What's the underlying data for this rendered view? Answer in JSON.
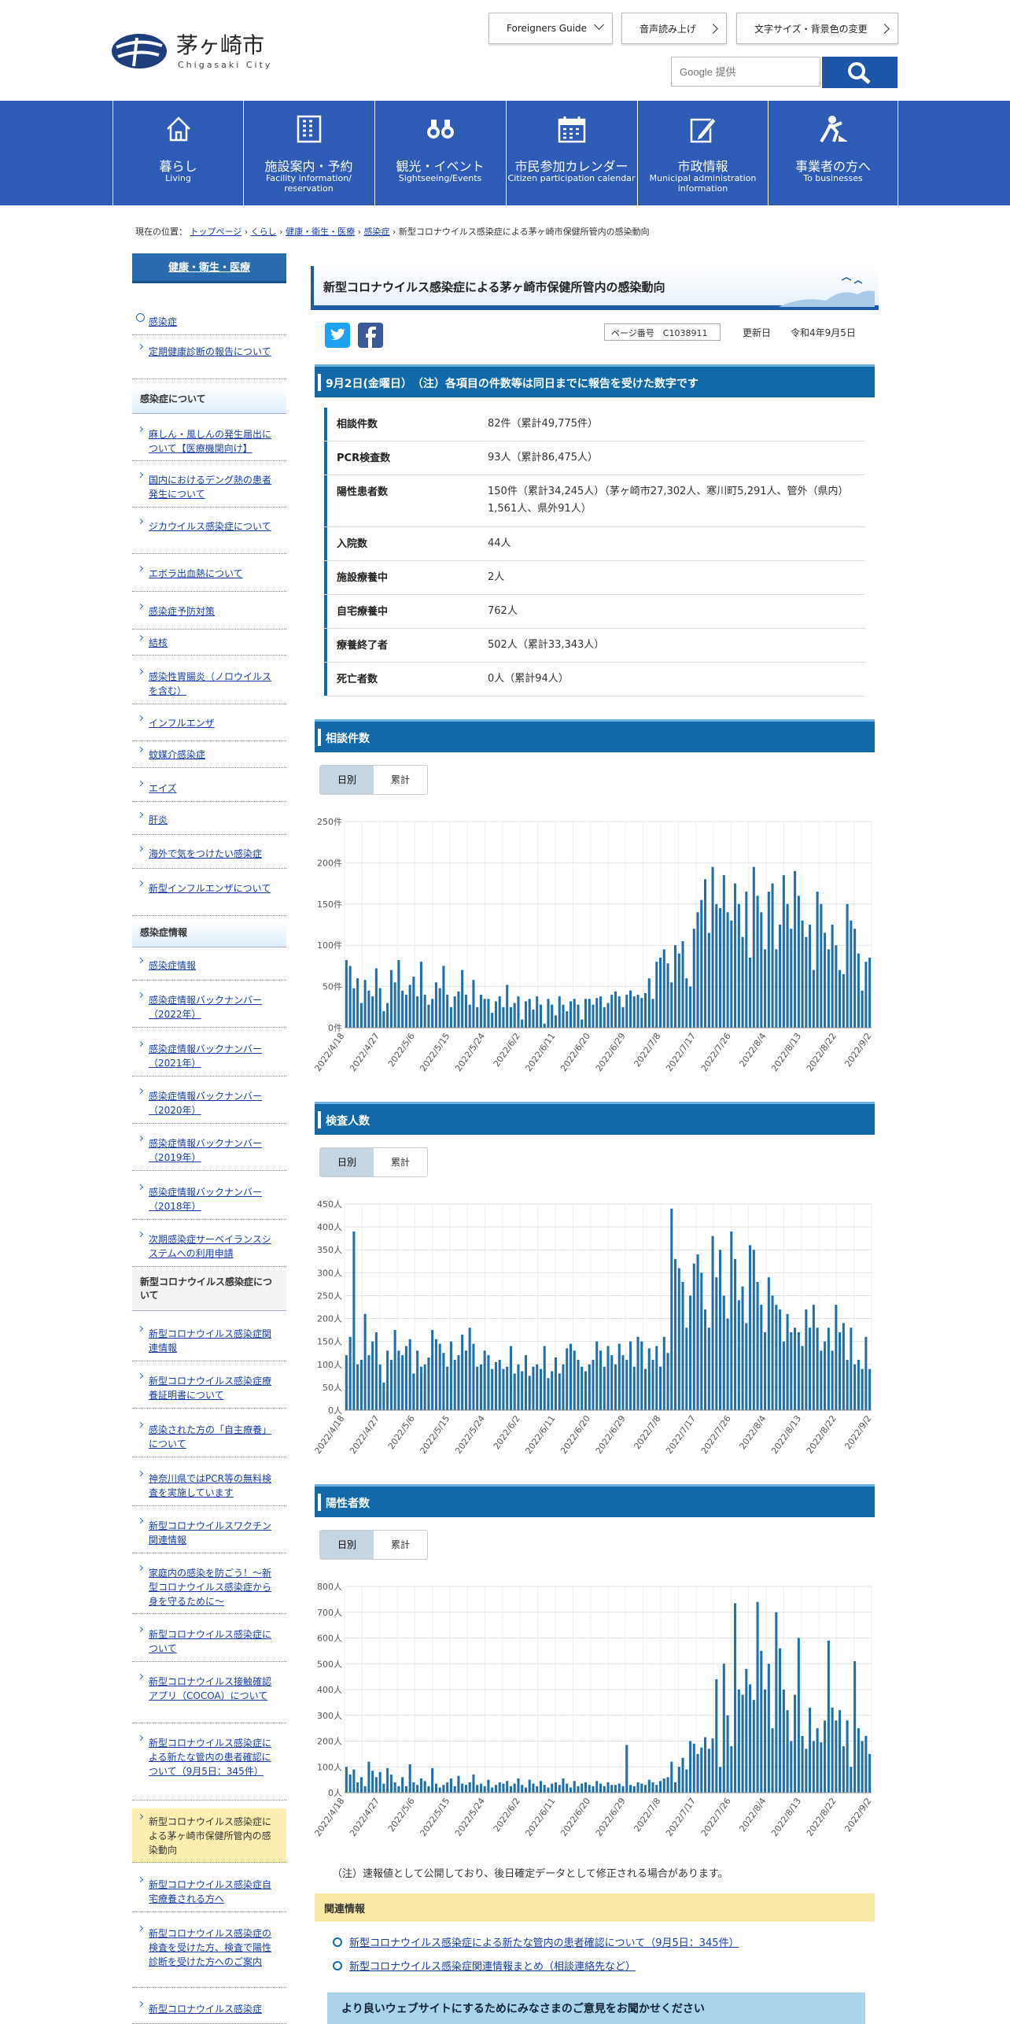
{
  "header": {
    "logo_jp": "茅ヶ崎市",
    "logo_en": "Chigasaki City",
    "btn_foreign": "Foreigners Guide",
    "btn_voice": "音声読み上げ",
    "btn_font": "文字サイズ・背景色の変更",
    "search_placeholder": "Google 提供"
  },
  "nav": [
    {
      "jp": "暮らし",
      "en": "Living",
      "icon": "house-icon"
    },
    {
      "jp": "施設案内・予約",
      "en": "Facility information/ reservation",
      "icon": "building-icon"
    },
    {
      "jp": "観光・イベント",
      "en": "Sightseeing/Events",
      "icon": "binoculars-icon"
    },
    {
      "jp": "市民参加カレンダー",
      "en": "Citizen participation calendar",
      "icon": "calendar-icon"
    },
    {
      "jp": "市政情報",
      "en": "Municipal administration information",
      "icon": "pen-icon"
    },
    {
      "jp": "事業者の方へ",
      "en": "To businesses",
      "icon": "worker-icon"
    }
  ],
  "breadcrumb": {
    "prefix": "現在の位置：",
    "items": [
      "トップページ",
      "くらし",
      "健康・衛生・医療",
      "感染症"
    ],
    "current": "新型コロナウイルス感染症による茅ヶ崎市保健所管内の感染動向"
  },
  "sidebar": {
    "heading": "健康・衛生・医療",
    "items": [
      {
        "t": "感染症",
        "k": "circ"
      },
      {
        "t": "定期健康診断の報告について",
        "k": "i"
      },
      {
        "t": "感染症について",
        "k": "g"
      },
      {
        "t": "麻しん・風しんの発生届出について【医療機関向け】",
        "k": "i"
      },
      {
        "t": "国内におけるデング熱の患者発生について",
        "k": "i"
      },
      {
        "t": "ジカウイルス感染症について",
        "k": "i"
      },
      {
        "t": "エボラ出血熱について",
        "k": "i"
      },
      {
        "t": "感染症予防対策",
        "k": "i"
      },
      {
        "t": "結核",
        "k": "i"
      },
      {
        "t": "感染性胃腸炎（ノロウイルスを含む）",
        "k": "i"
      },
      {
        "t": "インフルエンザ",
        "k": "i"
      },
      {
        "t": "蚊媒介感染症",
        "k": "i"
      },
      {
        "t": "エイズ",
        "k": "i"
      },
      {
        "t": "肝炎",
        "k": "i"
      },
      {
        "t": "海外で気をつけたい感染症",
        "k": "i"
      },
      {
        "t": "新型インフルエンザについて",
        "k": "i"
      },
      {
        "t": "感染症情報",
        "k": "g"
      },
      {
        "t": "感染症情報",
        "k": "i"
      },
      {
        "t": "感染症情報バックナンバー（2022年）",
        "k": "i"
      },
      {
        "t": "感染症情報バックナンバー（2021年）",
        "k": "i"
      },
      {
        "t": "感染症情報バックナンバー（2020年）",
        "k": "i"
      },
      {
        "t": "感染症情報バックナンバー（2019年）",
        "k": "i"
      },
      {
        "t": "感染症情報バックナンバー（2018年）",
        "k": "i"
      },
      {
        "t": "次期感染症サーベイランスシステムへの利用申請",
        "k": "i"
      },
      {
        "t": "新型コロナウイルス感染症について",
        "k": "gw"
      },
      {
        "t": "新型コロナウイルス感染症関連情報",
        "k": "i"
      },
      {
        "t": "新型コロナウイルス感染症療養証明書について",
        "k": "i"
      },
      {
        "t": "感染された方の「自主療養」について",
        "k": "i"
      },
      {
        "t": "神奈川県ではPCR等の無料検査を実施しています",
        "k": "i"
      },
      {
        "t": "新型コロナウイルスワクチン関連情報",
        "k": "i"
      },
      {
        "t": "家庭内の感染を防ごう！～新型コロナウイルス感染症から身を守るために～",
        "k": "i"
      },
      {
        "t": "新型コロナウイルス感染症について",
        "k": "i"
      },
      {
        "t": "新型コロナウイルス接触確認アプリ（COCOA）について",
        "k": "i"
      },
      {
        "t": "新型コロナウイルス感染症による新たな管内の患者確認について（9月5日：345件）",
        "k": "i"
      },
      {
        "t": "新型コロナウイルス感染症による茅ヶ崎市保健所管内の感染動向",
        "k": "cur"
      },
      {
        "t": "新型コロナウイルス感染症自宅療養される方へ",
        "k": "i"
      },
      {
        "t": "新型コロナウイルス感染症の検査を受けた方、検査で陽性診断を受けた方へのご案内",
        "k": "i"
      },
      {
        "t": "新型コロナウイルス感染症",
        "k": "i"
      }
    ]
  },
  "page": {
    "title": "新型コロナウイルス感染症による茅ヶ崎市保健所管内の感染動向",
    "page_no": "ページ番号　C1038911",
    "updated_label": "更新日",
    "updated": "令和4年9月5日",
    "summary_heading": "9月2日(金曜日）　（注）各項目の件数等は同日までに報告を受けた数字です",
    "summary": [
      {
        "k": "相談件数",
        "v": "82件（累計49,775件）"
      },
      {
        "k": "PCR検査数",
        "v": "93人（累計86,475人）"
      },
      {
        "k": "陽性患者数",
        "v": "150件（累計34,245人）（茅ヶ崎市27,302人、寒川町5,291人、管外（県内）1,561人、県外91人）"
      },
      {
        "k": "入院数",
        "v": "44人"
      },
      {
        "k": "施設療養中",
        "v": "2人"
      },
      {
        "k": "自宅療養中",
        "v": "762人"
      },
      {
        "k": "療養終了者",
        "v": "502人（累計33,343人）"
      },
      {
        "k": "死亡者数",
        "v": "0人（累計94人）"
      }
    ],
    "tab_daily": "日別",
    "tab_cumulative": "累計",
    "note": "（注）速報値として公開しており、後日確定データとして修正される場合があります。",
    "related_heading": "関連情報",
    "related": [
      "新型コロナウイルス感染症による新たな管内の患者確認について（9月5日：345件）",
      "新型コロナウイルス感染症関連情報まとめ（相談連絡先など）"
    ],
    "feedback": "より良いウェブサイトにするためにみなさまのご意見をお聞かせください"
  },
  "colors": {
    "nav": "#2e5bb5",
    "bar": "#1169aa",
    "chart": "#1f6fa8"
  },
  "chart_data": [
    {
      "type": "bar",
      "title": "相談件数",
      "x_start": "2022/4/18",
      "x_end": "2022/9/2",
      "tick_labels": [
        "2022/4/18",
        "2022/4/27",
        "2022/5/6",
        "2022/5/15",
        "2022/5/24",
        "2022/6/2",
        "2022/6/11",
        "2022/6/20",
        "2022/6/29",
        "2022/7/8",
        "2022/7/17",
        "2022/7/26",
        "2022/8/4",
        "2022/8/13",
        "2022/8/22",
        "2022/9/2"
      ],
      "y_ticks": [
        "0件",
        "50件",
        "100件",
        "150件",
        "200件",
        "250件"
      ],
      "ylim": [
        0,
        250
      ],
      "values": [
        82,
        75,
        48,
        60,
        30,
        58,
        45,
        38,
        72,
        48,
        20,
        30,
        70,
        55,
        82,
        45,
        40,
        52,
        62,
        38,
        80,
        40,
        28,
        35,
        55,
        48,
        75,
        40,
        25,
        38,
        44,
        70,
        40,
        28,
        58,
        25,
        40,
        35,
        35,
        18,
        32,
        38,
        25,
        52,
        25,
        30,
        38,
        10,
        32,
        35,
        22,
        38,
        28,
        5,
        35,
        28,
        15,
        38,
        28,
        20,
        32,
        35,
        28,
        10,
        35,
        35,
        28,
        36,
        38,
        25,
        30,
        40,
        44,
        38,
        25,
        40,
        45,
        38,
        40,
        36,
        42,
        60,
        35,
        80,
        85,
        95,
        78,
        55,
        100,
        90,
        105,
        60,
        50,
        120,
        140,
        155,
        180,
        115,
        195,
        150,
        145,
        185,
        140,
        130,
        175,
        150,
        110,
        165,
        85,
        195,
        160,
        140,
        95,
        165,
        175,
        95,
        125,
        185,
        150,
        120,
        190,
        160,
        130,
        110,
        125,
        70,
        165,
        150,
        115,
        95,
        125,
        100,
        70,
        65,
        150,
        130,
        120,
        90,
        45,
        80,
        85
      ]
    },
    {
      "type": "bar",
      "title": "検査人数",
      "x_start": "2022/4/18",
      "x_end": "2022/9/2",
      "tick_labels": [
        "2022/4/18",
        "2022/4/27",
        "2022/5/6",
        "2022/5/15",
        "2022/5/24",
        "2022/6/2",
        "2022/6/11",
        "2022/6/20",
        "2022/6/29",
        "2022/7/8",
        "2022/7/17",
        "2022/7/26",
        "2022/8/4",
        "2022/8/13",
        "2022/8/22",
        "2022/9/2"
      ],
      "y_ticks": [
        "0人",
        "50人",
        "100人",
        "150人",
        "200人",
        "250人",
        "300人",
        "350人",
        "400人",
        "450人"
      ],
      "ylim": [
        0,
        450
      ],
      "values": [
        120,
        160,
        390,
        100,
        110,
        210,
        120,
        150,
        170,
        100,
        60,
        130,
        110,
        175,
        130,
        120,
        140,
        155,
        80,
        130,
        95,
        100,
        115,
        175,
        155,
        145,
        125,
        95,
        150,
        110,
        120,
        165,
        130,
        180,
        145,
        95,
        100,
        130,
        120,
        90,
        105,
        110,
        90,
        95,
        140,
        80,
        100,
        85,
        120,
        75,
        95,
        100,
        90,
        140,
        70,
        85,
        115,
        80,
        100,
        135,
        145,
        130,
        110,
        95,
        85,
        100,
        110,
        150,
        130,
        95,
        140,
        120,
        100,
        145,
        120,
        110,
        150,
        95,
        160,
        150,
        90,
        135,
        110,
        140,
        95,
        160,
        125,
        440,
        330,
        310,
        280,
        180,
        250,
        320,
        340,
        300,
        220,
        180,
        380,
        290,
        350,
        250,
        200,
        390,
        330,
        240,
        270,
        190,
        360,
        350,
        280,
        230,
        170,
        290,
        250,
        230,
        220,
        150,
        210,
        170,
        180,
        170,
        140,
        220,
        180,
        230,
        180,
        130,
        150,
        180,
        130,
        230,
        170,
        190,
        110,
        180,
        100,
        110,
        90,
        160,
        90
      ]
    },
    {
      "type": "bar",
      "title": "陽性者数",
      "x_start": "2022/4/18",
      "x_end": "2022/9/2",
      "tick_labels": [
        "2022/4/18",
        "2022/4/27",
        "2022/5/6",
        "2022/5/15",
        "2022/5/24",
        "2022/6/2",
        "2022/6/11",
        "2022/6/20",
        "2022/6/29",
        "2022/7/8",
        "2022/7/17",
        "2022/7/26",
        "2022/8/4",
        "2022/8/13",
        "2022/8/22",
        "2022/9/2"
      ],
      "y_ticks": [
        "0人",
        "100人",
        "200人",
        "300人",
        "400人",
        "500人",
        "600人",
        "700人",
        "800人"
      ],
      "ylim": [
        0,
        800
      ],
      "values": [
        100,
        70,
        90,
        40,
        60,
        25,
        120,
        85,
        60,
        80,
        35,
        95,
        70,
        40,
        25,
        60,
        25,
        110,
        40,
        30,
        55,
        45,
        25,
        95,
        35,
        20,
        30,
        40,
        55,
        25,
        65,
        35,
        30,
        40,
        70,
        30,
        35,
        25,
        50,
        20,
        30,
        40,
        35,
        45,
        25,
        35,
        55,
        30,
        20,
        50,
        35,
        25,
        45,
        30,
        20,
        35,
        40,
        30,
        55,
        35,
        20,
        45,
        25,
        35,
        40,
        30,
        25,
        45,
        35,
        25,
        40,
        30,
        30,
        35,
        25,
        185,
        30,
        25,
        40,
        35,
        30,
        50,
        40,
        30,
        45,
        55,
        60,
        120,
        40,
        100,
        135,
        90,
        200,
        190,
        150,
        175,
        215,
        170,
        210,
        440,
        100,
        500,
        300,
        180,
        735,
        400,
        380,
        480,
        420,
        360,
        740,
        550,
        400,
        500,
        250,
        700,
        560,
        400,
        320,
        200,
        380,
        600,
        220,
        170,
        330,
        200,
        250,
        195,
        280,
        590,
        330,
        280,
        320,
        180,
        280,
        100,
        510,
        250,
        200,
        220,
        150
      ]
    }
  ]
}
